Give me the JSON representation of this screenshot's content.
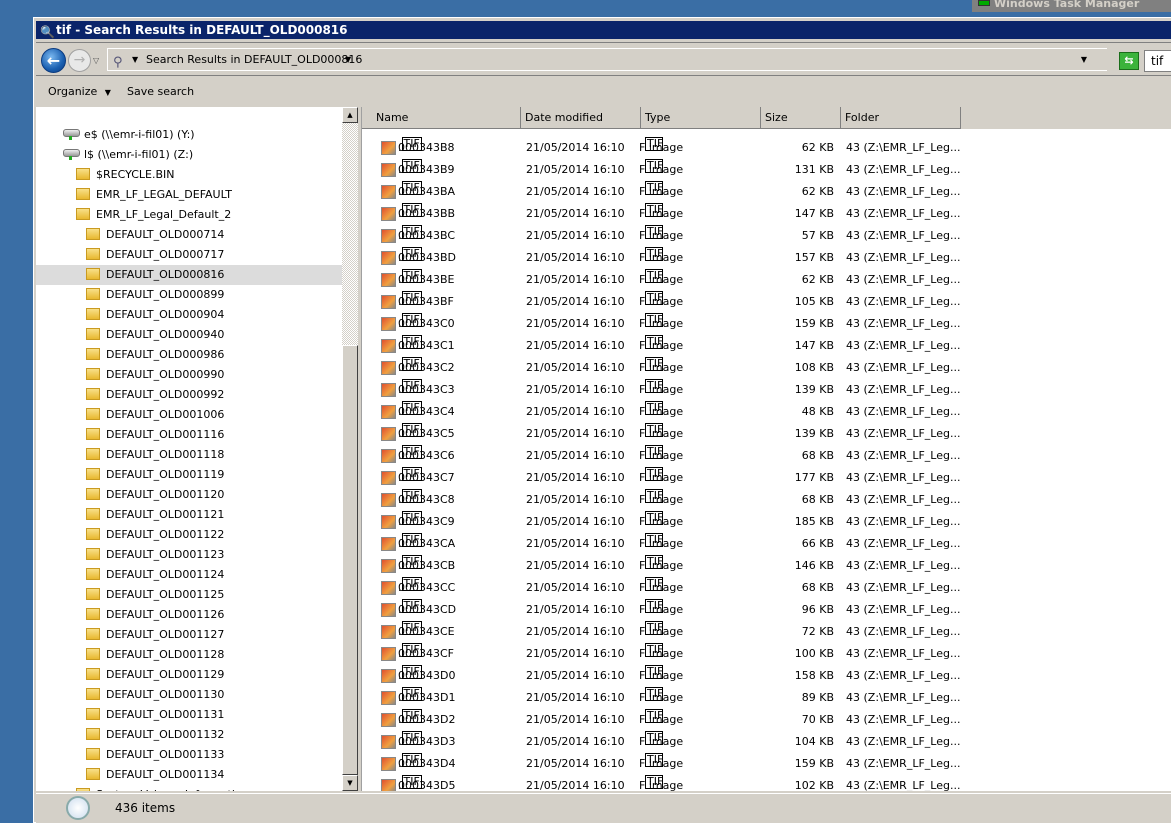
{
  "background_window": {
    "title": "Windows Task Manager"
  },
  "window": {
    "title": "tif - Search Results in DEFAULT_OLD000816"
  },
  "address": {
    "breadcrumb": "Search Results in DEFAULT_OLD000816",
    "search_value": "tif"
  },
  "toolbar": {
    "organize": "Organize",
    "save_search": "Save search"
  },
  "tree": [
    {
      "label": "e$ (\\\\emr-i-fil01) (Y:)",
      "type": "drive",
      "level": 0
    },
    {
      "label": "l$ (\\\\emr-i-fil01) (Z:)",
      "type": "drive",
      "level": 0
    },
    {
      "label": "$RECYCLE.BIN",
      "type": "folder",
      "level": 1
    },
    {
      "label": "EMR_LF_LEGAL_DEFAULT",
      "type": "folder",
      "level": 1
    },
    {
      "label": "EMR_LF_Legal_Default_2",
      "type": "folder",
      "level": 1
    },
    {
      "label": "DEFAULT_OLD000714",
      "type": "folder",
      "level": 2
    },
    {
      "label": "DEFAULT_OLD000717",
      "type": "folder",
      "level": 2
    },
    {
      "label": "DEFAULT_OLD000816",
      "type": "folder",
      "level": 2,
      "selected": true
    },
    {
      "label": "DEFAULT_OLD000899",
      "type": "folder",
      "level": 2
    },
    {
      "label": "DEFAULT_OLD000904",
      "type": "folder",
      "level": 2
    },
    {
      "label": "DEFAULT_OLD000940",
      "type": "folder",
      "level": 2
    },
    {
      "label": "DEFAULT_OLD000986",
      "type": "folder",
      "level": 2
    },
    {
      "label": "DEFAULT_OLD000990",
      "type": "folder",
      "level": 2
    },
    {
      "label": "DEFAULT_OLD000992",
      "type": "folder",
      "level": 2
    },
    {
      "label": "DEFAULT_OLD001006",
      "type": "folder",
      "level": 2
    },
    {
      "label": "DEFAULT_OLD001116",
      "type": "folder",
      "level": 2
    },
    {
      "label": "DEFAULT_OLD001118",
      "type": "folder",
      "level": 2
    },
    {
      "label": "DEFAULT_OLD001119",
      "type": "folder",
      "level": 2
    },
    {
      "label": "DEFAULT_OLD001120",
      "type": "folder",
      "level": 2
    },
    {
      "label": "DEFAULT_OLD001121",
      "type": "folder",
      "level": 2
    },
    {
      "label": "DEFAULT_OLD001122",
      "type": "folder",
      "level": 2
    },
    {
      "label": "DEFAULT_OLD001123",
      "type": "folder",
      "level": 2
    },
    {
      "label": "DEFAULT_OLD001124",
      "type": "folder",
      "level": 2
    },
    {
      "label": "DEFAULT_OLD001125",
      "type": "folder",
      "level": 2
    },
    {
      "label": "DEFAULT_OLD001126",
      "type": "folder",
      "level": 2
    },
    {
      "label": "DEFAULT_OLD001127",
      "type": "folder",
      "level": 2
    },
    {
      "label": "DEFAULT_OLD001128",
      "type": "folder",
      "level": 2
    },
    {
      "label": "DEFAULT_OLD001129",
      "type": "folder",
      "level": 2
    },
    {
      "label": "DEFAULT_OLD001130",
      "type": "folder",
      "level": 2
    },
    {
      "label": "DEFAULT_OLD001131",
      "type": "folder",
      "level": 2
    },
    {
      "label": "DEFAULT_OLD001132",
      "type": "folder",
      "level": 2
    },
    {
      "label": "DEFAULT_OLD001133",
      "type": "folder",
      "level": 2
    },
    {
      "label": "DEFAULT_OLD001134",
      "type": "folder",
      "level": 2
    },
    {
      "label": "System Volume Information",
      "type": "folder",
      "level": 1
    }
  ],
  "columns": [
    "Name",
    "Date modified",
    "Type",
    "Size",
    "Folder"
  ],
  "files": [
    {
      "name": "000343B8",
      "ext": "TIF",
      "date": "21/05/2014 16:10",
      "type_hl": "TIF",
      "type_rest": "F image",
      "size": "62 KB",
      "folder": "43 (Z:\\EMR_LF_Leg..."
    },
    {
      "name": "000343B9",
      "ext": "TIF",
      "date": "21/05/2014 16:10",
      "type_hl": "TIF",
      "type_rest": "F image",
      "size": "131 KB",
      "folder": "43 (Z:\\EMR_LF_Leg..."
    },
    {
      "name": "000343BA",
      "ext": "TIF",
      "date": "21/05/2014 16:10",
      "type_hl": "TIF",
      "type_rest": "F image",
      "size": "62 KB",
      "folder": "43 (Z:\\EMR_LF_Leg..."
    },
    {
      "name": "000343BB",
      "ext": "TIF",
      "date": "21/05/2014 16:10",
      "type_hl": "TIF",
      "type_rest": "F image",
      "size": "147 KB",
      "folder": "43 (Z:\\EMR_LF_Leg..."
    },
    {
      "name": "000343BC",
      "ext": "TIF",
      "date": "21/05/2014 16:10",
      "type_hl": "TIF",
      "type_rest": "F image",
      "size": "57 KB",
      "folder": "43 (Z:\\EMR_LF_Leg..."
    },
    {
      "name": "000343BD",
      "ext": "TIF",
      "date": "21/05/2014 16:10",
      "type_hl": "TIF",
      "type_rest": "F image",
      "size": "157 KB",
      "folder": "43 (Z:\\EMR_LF_Leg..."
    },
    {
      "name": "000343BE",
      "ext": "TIF",
      "date": "21/05/2014 16:10",
      "type_hl": "TIF",
      "type_rest": "F image",
      "size": "62 KB",
      "folder": "43 (Z:\\EMR_LF_Leg..."
    },
    {
      "name": "000343BF",
      "ext": "TIF",
      "date": "21/05/2014 16:10",
      "type_hl": "TIF",
      "type_rest": "F image",
      "size": "105 KB",
      "folder": "43 (Z:\\EMR_LF_Leg..."
    },
    {
      "name": "000343C0",
      "ext": "TIF",
      "date": "21/05/2014 16:10",
      "type_hl": "TIF",
      "type_rest": "F image",
      "size": "159 KB",
      "folder": "43 (Z:\\EMR_LF_Leg..."
    },
    {
      "name": "000343C1",
      "ext": "TIF",
      "date": "21/05/2014 16:10",
      "type_hl": "TIF",
      "type_rest": "F image",
      "size": "147 KB",
      "folder": "43 (Z:\\EMR_LF_Leg..."
    },
    {
      "name": "000343C2",
      "ext": "TIF",
      "date": "21/05/2014 16:10",
      "type_hl": "TIF",
      "type_rest": "F image",
      "size": "108 KB",
      "folder": "43 (Z:\\EMR_LF_Leg..."
    },
    {
      "name": "000343C3",
      "ext": "TIF",
      "date": "21/05/2014 16:10",
      "type_hl": "TIF",
      "type_rest": "F image",
      "size": "139 KB",
      "folder": "43 (Z:\\EMR_LF_Leg..."
    },
    {
      "name": "000343C4",
      "ext": "TIF",
      "date": "21/05/2014 16:10",
      "type_hl": "TIF",
      "type_rest": "F image",
      "size": "48 KB",
      "folder": "43 (Z:\\EMR_LF_Leg..."
    },
    {
      "name": "000343C5",
      "ext": "TIF",
      "date": "21/05/2014 16:10",
      "type_hl": "TIF",
      "type_rest": "F image",
      "size": "139 KB",
      "folder": "43 (Z:\\EMR_LF_Leg..."
    },
    {
      "name": "000343C6",
      "ext": "TIF",
      "date": "21/05/2014 16:10",
      "type_hl": "TIF",
      "type_rest": "F image",
      "size": "68 KB",
      "folder": "43 (Z:\\EMR_LF_Leg..."
    },
    {
      "name": "000343C7",
      "ext": "TIF",
      "date": "21/05/2014 16:10",
      "type_hl": "TIF",
      "type_rest": "F image",
      "size": "177 KB",
      "folder": "43 (Z:\\EMR_LF_Leg..."
    },
    {
      "name": "000343C8",
      "ext": "TIF",
      "date": "21/05/2014 16:10",
      "type_hl": "TIF",
      "type_rest": "F image",
      "size": "68 KB",
      "folder": "43 (Z:\\EMR_LF_Leg..."
    },
    {
      "name": "000343C9",
      "ext": "TIF",
      "date": "21/05/2014 16:10",
      "type_hl": "TIF",
      "type_rest": "F image",
      "size": "185 KB",
      "folder": "43 (Z:\\EMR_LF_Leg..."
    },
    {
      "name": "000343CA",
      "ext": "TIF",
      "date": "21/05/2014 16:10",
      "type_hl": "TIF",
      "type_rest": "F image",
      "size": "66 KB",
      "folder": "43 (Z:\\EMR_LF_Leg..."
    },
    {
      "name": "000343CB",
      "ext": "TIF",
      "date": "21/05/2014 16:10",
      "type_hl": "TIF",
      "type_rest": "F image",
      "size": "146 KB",
      "folder": "43 (Z:\\EMR_LF_Leg..."
    },
    {
      "name": "000343CC",
      "ext": "TIF",
      "date": "21/05/2014 16:10",
      "type_hl": "TIF",
      "type_rest": "F image",
      "size": "68 KB",
      "folder": "43 (Z:\\EMR_LF_Leg..."
    },
    {
      "name": "000343CD",
      "ext": "TIF",
      "date": "21/05/2014 16:10",
      "type_hl": "TIF",
      "type_rest": "F image",
      "size": "96 KB",
      "folder": "43 (Z:\\EMR_LF_Leg..."
    },
    {
      "name": "000343CE",
      "ext": "TIF",
      "date": "21/05/2014 16:10",
      "type_hl": "TIF",
      "type_rest": "F image",
      "size": "72 KB",
      "folder": "43 (Z:\\EMR_LF_Leg..."
    },
    {
      "name": "000343CF",
      "ext": "TIF",
      "date": "21/05/2014 16:10",
      "type_hl": "TIF",
      "type_rest": "F image",
      "size": "100 KB",
      "folder": "43 (Z:\\EMR_LF_Leg..."
    },
    {
      "name": "000343D0",
      "ext": "TIF",
      "date": "21/05/2014 16:10",
      "type_hl": "TIF",
      "type_rest": "F image",
      "size": "158 KB",
      "folder": "43 (Z:\\EMR_LF_Leg..."
    },
    {
      "name": "000343D1",
      "ext": "TIF",
      "date": "21/05/2014 16:10",
      "type_hl": "TIF",
      "type_rest": "F image",
      "size": "89 KB",
      "folder": "43 (Z:\\EMR_LF_Leg..."
    },
    {
      "name": "000343D2",
      "ext": "TIF",
      "date": "21/05/2014 16:10",
      "type_hl": "TIF",
      "type_rest": "F image",
      "size": "70 KB",
      "folder": "43 (Z:\\EMR_LF_Leg..."
    },
    {
      "name": "000343D3",
      "ext": "TIF",
      "date": "21/05/2014 16:10",
      "type_hl": "TIF",
      "type_rest": "F image",
      "size": "104 KB",
      "folder": "43 (Z:\\EMR_LF_Leg..."
    },
    {
      "name": "000343D4",
      "ext": "TIF",
      "date": "21/05/2014 16:10",
      "type_hl": "TIF",
      "type_rest": "F image",
      "size": "159 KB",
      "folder": "43 (Z:\\EMR_LF_Leg..."
    },
    {
      "name": "000343D5",
      "ext": "TIF",
      "date": "21/05/2014 16:10",
      "type_hl": "TIF",
      "type_rest": "F image",
      "size": "102 KB",
      "folder": "43 (Z:\\EMR_LF_Leg..."
    }
  ],
  "status": {
    "item_count": "436 items"
  },
  "colors": {
    "titlebar": "#0a246a",
    "chrome": "#d4d0c8",
    "selection": "#dcdcdc"
  }
}
